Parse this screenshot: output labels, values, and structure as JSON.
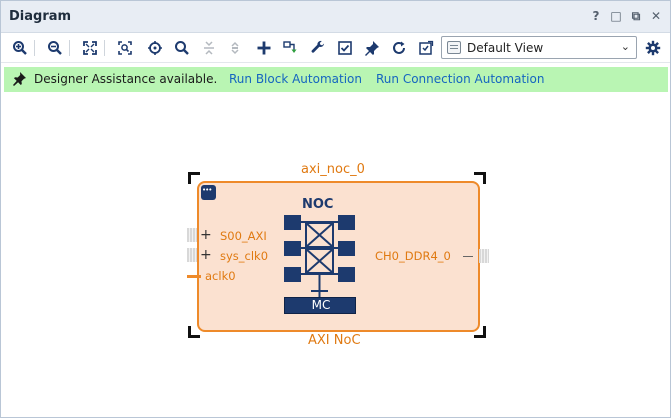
{
  "panel": {
    "title": "Diagram",
    "controls": [
      "?",
      "□",
      "⧉",
      "✕"
    ]
  },
  "toolbar": {
    "view_select": "Default View",
    "icons": [
      "zoom-in-icon",
      "zoom-out-icon",
      "fit-view-icon",
      "zoom-area-icon",
      "center-icon",
      "search-icon",
      "collapse-icon",
      "expand-icon",
      "add-ip-icon",
      "make-connection-icon",
      "wrench-icon",
      "validate-icon",
      "pin-icon",
      "refresh-icon",
      "regenerate-layout-icon",
      "gear-icon"
    ]
  },
  "banner": {
    "message": "Designer Assistance available.",
    "link_block": "Run Block Automation",
    "link_connection": "Run Connection Automation"
  },
  "block": {
    "instance_name": "axi_noc_0",
    "ip_name": "AXI NoC",
    "symbol_title": "NOC",
    "symbol_mc": "MC",
    "ports_in": [
      "S00_AXI",
      "sys_clk0",
      "aclk0"
    ],
    "ports_out": [
      "CH0_DDR4_0"
    ]
  },
  "colors": {
    "accent_orange": "#ee8a2a",
    "block_fill": "#fbe1d0",
    "noc_blue": "#1d3a6e",
    "banner_green": "#b9f5b3",
    "link_blue": "#1565c0"
  }
}
